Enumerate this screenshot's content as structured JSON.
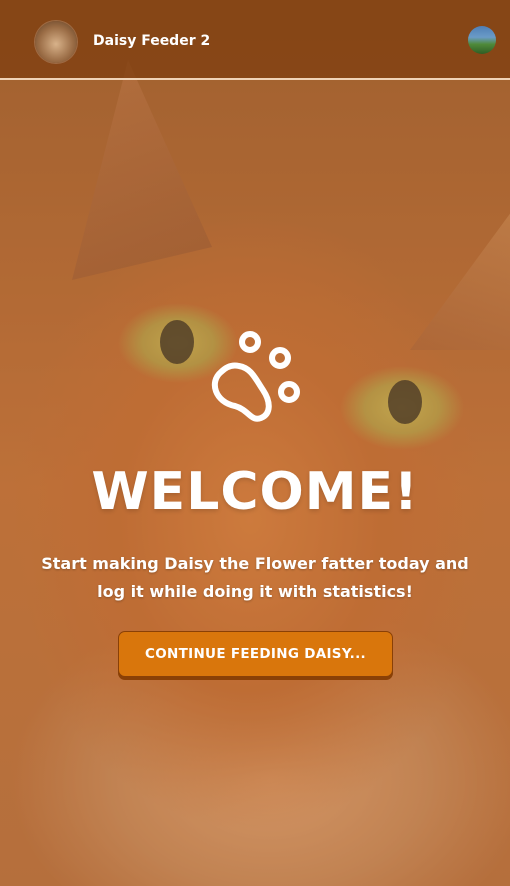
{
  "header": {
    "app_title": "Daisy Feeder 2"
  },
  "hero": {
    "heading": "WELCOME!",
    "subtitle": "Start making Daisy the Flower fatter today and log it while doing it with statistics!",
    "cta_label": "CONTINUE FEEDING DAISY..."
  },
  "icons": {
    "app_avatar": "cat-avatar-icon",
    "user_avatar": "user-avatar-icon",
    "paw": "paw-icon"
  },
  "colors": {
    "header_bg": "#7e3d0f",
    "cta_bg": "#d9760c",
    "text": "#ffffff"
  }
}
